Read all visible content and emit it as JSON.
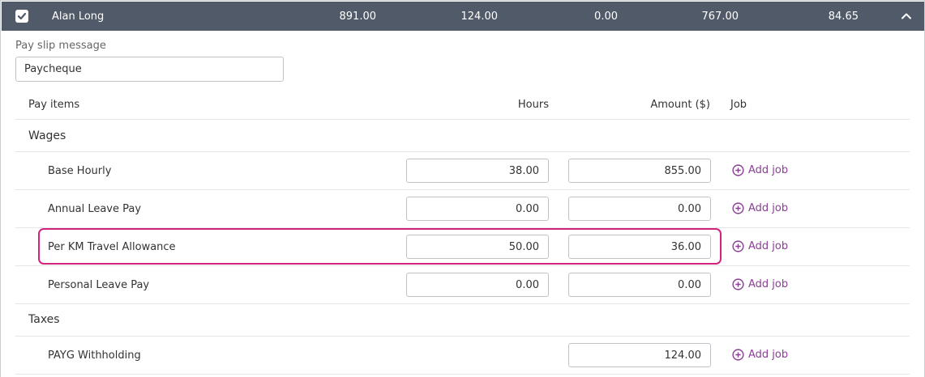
{
  "employee": {
    "name": "Alan Long",
    "values": [
      "891.00",
      "124.00",
      "0.00",
      "767.00",
      "84.65"
    ],
    "checked": true
  },
  "pay_slip": {
    "label": "Pay slip message",
    "value": "Paycheque"
  },
  "table": {
    "headers": {
      "pay_items": "Pay items",
      "hours": "Hours",
      "amount": "Amount ($)",
      "job": "Job"
    },
    "add_job_label": "Add job",
    "sections": {
      "wages": "Wages",
      "taxes": "Taxes"
    },
    "rows": [
      {
        "label": "Base Hourly",
        "hours": "38.00",
        "amount": "855.00"
      },
      {
        "label": "Annual Leave Pay",
        "hours": "0.00",
        "amount": "0.00"
      },
      {
        "label": "Per KM Travel Allowance",
        "hours": "50.00",
        "amount": "36.00"
      },
      {
        "label": "Personal Leave Pay",
        "hours": "0.00",
        "amount": "0.00"
      },
      {
        "label": "PAYG Withholding",
        "amount": "124.00"
      }
    ]
  },
  "colors": {
    "header_bg": "#505a68",
    "accent": "#8a3f94",
    "highlight": "#d2237f"
  },
  "icons": {
    "checkbox": "checkbox-checked-icon",
    "collapse": "chevron-up-icon",
    "add": "plus-circle-icon"
  }
}
